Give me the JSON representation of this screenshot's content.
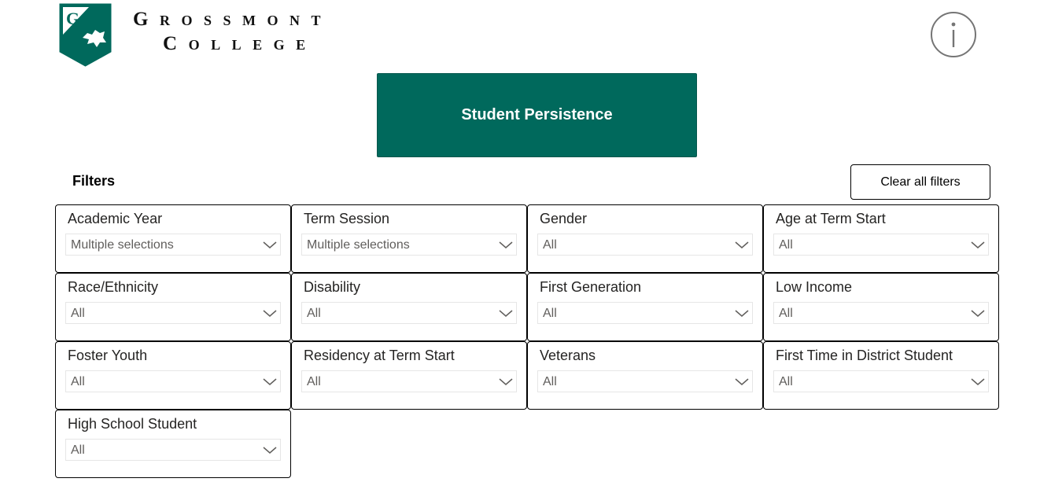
{
  "header": {
    "logo_text_line1": "GROSSMONT",
    "logo_text_line2": "COLLEGE",
    "logo_shield_letter": "G",
    "brand_color": "#00695c"
  },
  "info_button": {
    "icon": "info-circle-icon",
    "glyph": "i"
  },
  "title_button": {
    "label": "Student Persistence"
  },
  "filters": {
    "heading": "Filters",
    "clear_label": "Clear all filters",
    "slicers": [
      {
        "id": "academic-year",
        "title": "Academic Year",
        "value": "Multiple selections"
      },
      {
        "id": "term-session",
        "title": "Term Session",
        "value": "Multiple selections"
      },
      {
        "id": "gender",
        "title": "Gender",
        "value": "All"
      },
      {
        "id": "age-at-term-start",
        "title": "Age at Term Start",
        "value": "All"
      },
      {
        "id": "race-ethnicity",
        "title": "Race/Ethnicity",
        "value": "All"
      },
      {
        "id": "disability",
        "title": "Disability",
        "value": "All"
      },
      {
        "id": "first-generation",
        "title": "First Generation",
        "value": "All"
      },
      {
        "id": "low-income",
        "title": "Low Income",
        "value": "All"
      },
      {
        "id": "foster-youth",
        "title": "Foster Youth",
        "value": "All"
      },
      {
        "id": "residency-at-term-start",
        "title": "Residency at Term Start",
        "value": "All"
      },
      {
        "id": "veterans",
        "title": "Veterans",
        "value": "All"
      },
      {
        "id": "first-time-in-district-student",
        "title": "First Time in District Student",
        "value": "All"
      },
      {
        "id": "high-school-student",
        "title": "High School Student",
        "value": "All"
      }
    ]
  }
}
